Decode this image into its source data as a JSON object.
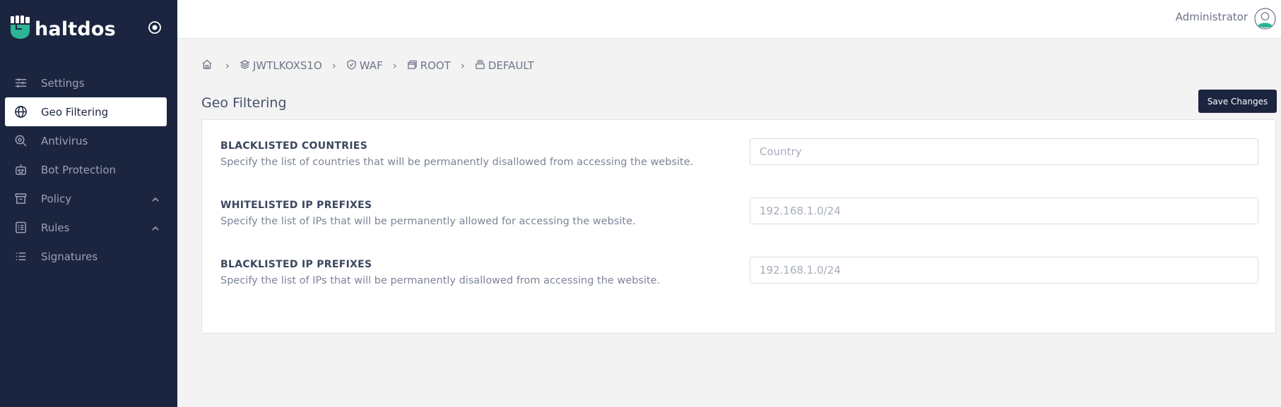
{
  "app": {
    "brand": "haltdos"
  },
  "colors": {
    "sidebar_bg": "#1b2540",
    "logo_accent": "#2bb594",
    "page_bg": "#f2f3f2"
  },
  "sidebar": {
    "items": [
      {
        "label": "Settings",
        "icon": "sliders-icon",
        "active": false,
        "expandable": false
      },
      {
        "label": "Geo Filtering",
        "icon": "globe-icon",
        "active": true,
        "expandable": false
      },
      {
        "label": "Antivirus",
        "icon": "search-bug-icon",
        "active": false,
        "expandable": false
      },
      {
        "label": "Bot Protection",
        "icon": "robot-icon",
        "active": false,
        "expandable": false
      },
      {
        "label": "Policy",
        "icon": "archive-icon",
        "active": false,
        "expandable": true
      },
      {
        "label": "Rules",
        "icon": "list-checks-icon",
        "active": false,
        "expandable": true
      },
      {
        "label": "Signatures",
        "icon": "list-icon",
        "active": false,
        "expandable": false
      }
    ]
  },
  "header": {
    "user_name": "Administrator"
  },
  "breadcrumb": [
    {
      "label": "",
      "icon": "home-icon"
    },
    {
      "label": "JWTLKOXS1O",
      "icon": "stack-icon"
    },
    {
      "label": "WAF",
      "icon": "shield-check-icon"
    },
    {
      "label": "ROOT",
      "icon": "windows-icon"
    },
    {
      "label": "DEFAULT",
      "icon": "stack-box-icon"
    }
  ],
  "page": {
    "title": "Geo Filtering",
    "save_label": "Save Changes"
  },
  "settings": [
    {
      "label": "BLACKLISTED COUNTRIES",
      "description": "Specify the list of countries that will be permanently disallowed from accessing the website.",
      "value": "",
      "placeholder": "Country"
    },
    {
      "label": "WHITELISTED IP PREFIXES",
      "description": "Specify the list of IPs that will be permanently allowed for accessing the website.",
      "value": "",
      "placeholder": "192.168.1.0/24"
    },
    {
      "label": "BLACKLISTED IP PREFIXES",
      "description": "Specify the list of IPs that will be permanently disallowed from accessing the website.",
      "value": "",
      "placeholder": "192.168.1.0/24"
    }
  ]
}
